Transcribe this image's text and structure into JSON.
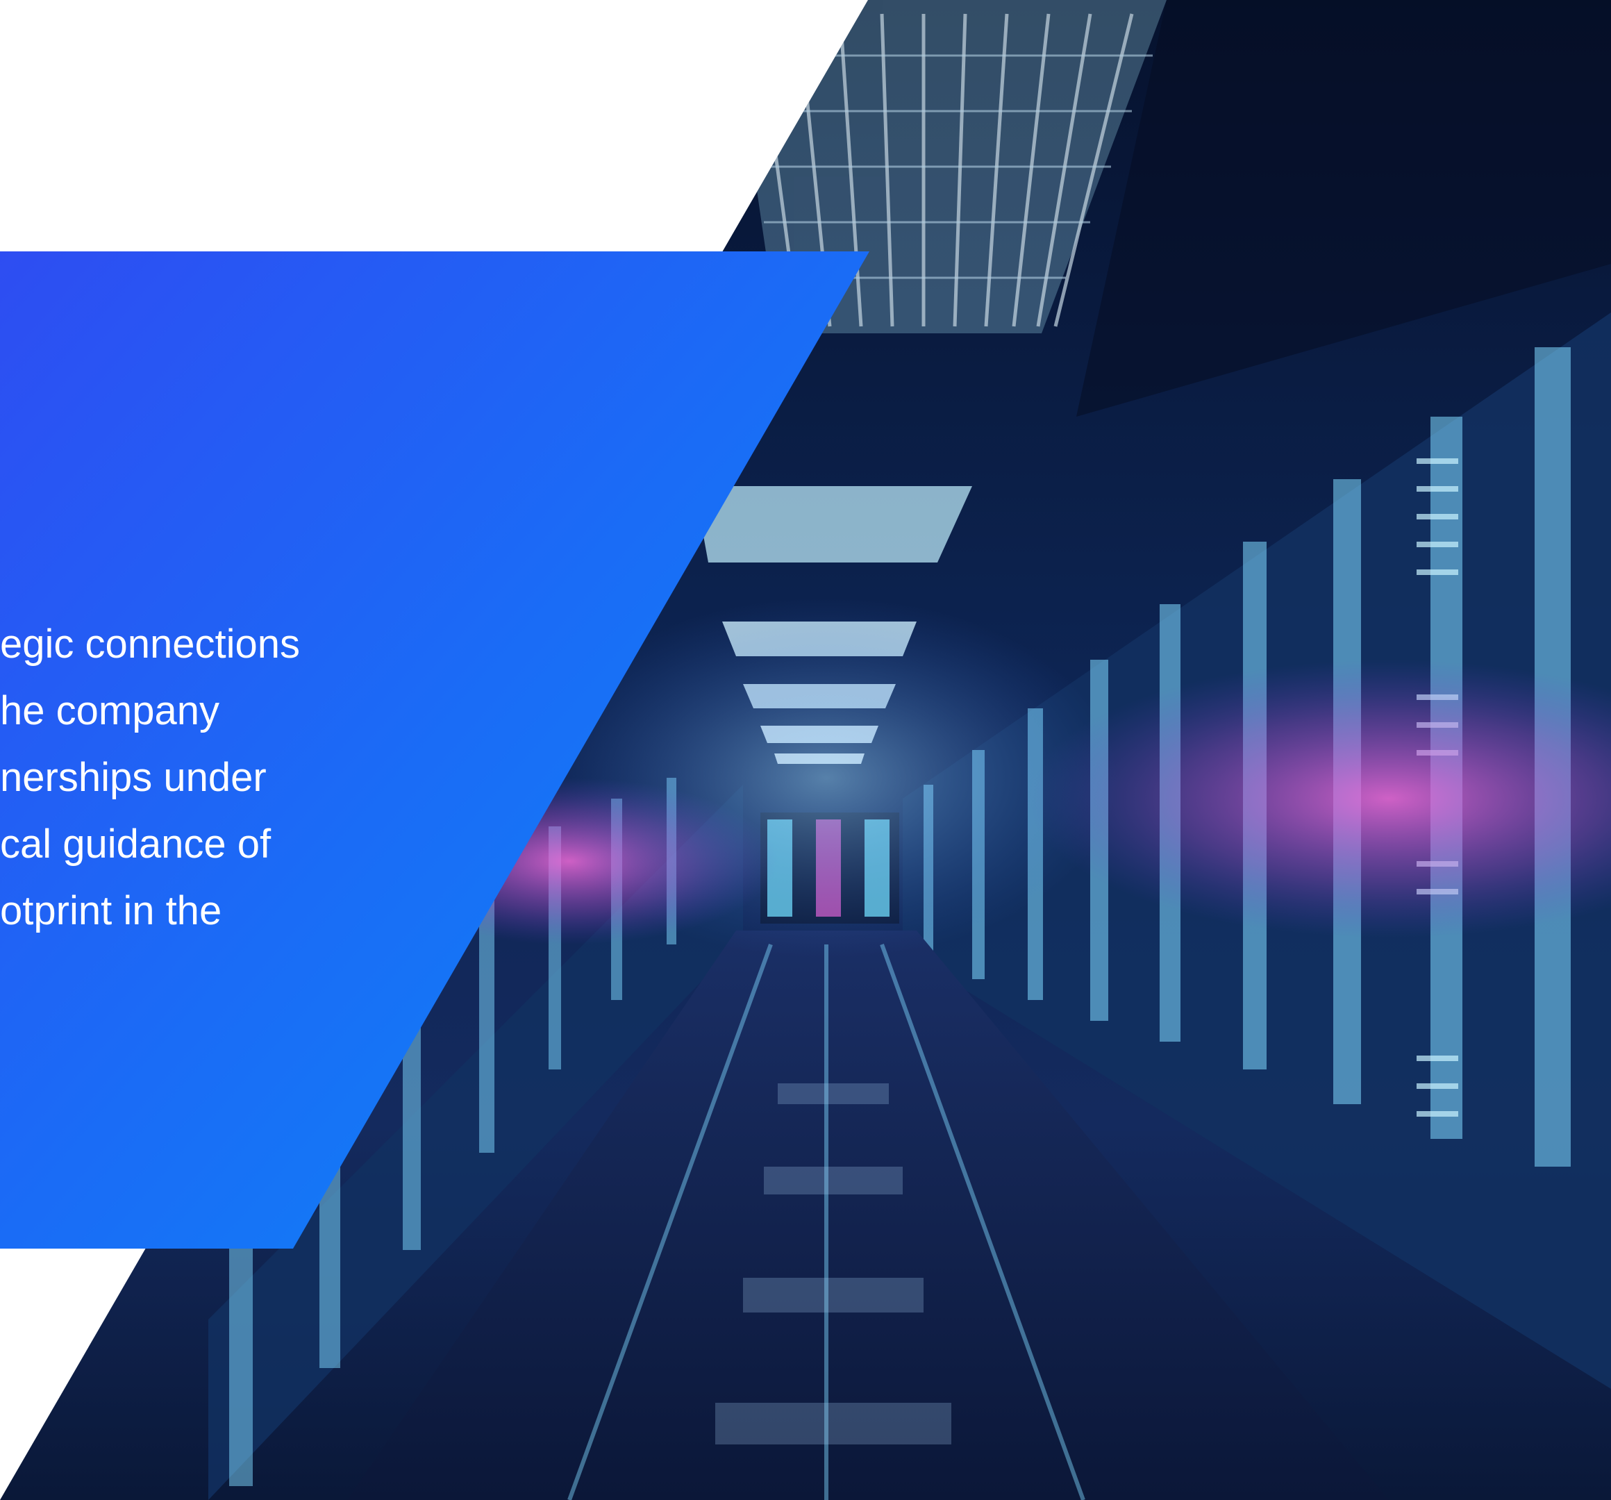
{
  "hero": {
    "text_lines": [
      "egic connections",
      "he company",
      "nerships under",
      "cal guidance of",
      "otprint in the"
    ]
  },
  "colors": {
    "background": "#ffffff",
    "panel_blue_top": "#2a56f2",
    "panel_blue_bottom": "#0a84f7",
    "datacenter_dark": "#0b1a3a",
    "datacenter_cyan": "#7fe7ff",
    "datacenter_magenta": "#e05acb"
  }
}
